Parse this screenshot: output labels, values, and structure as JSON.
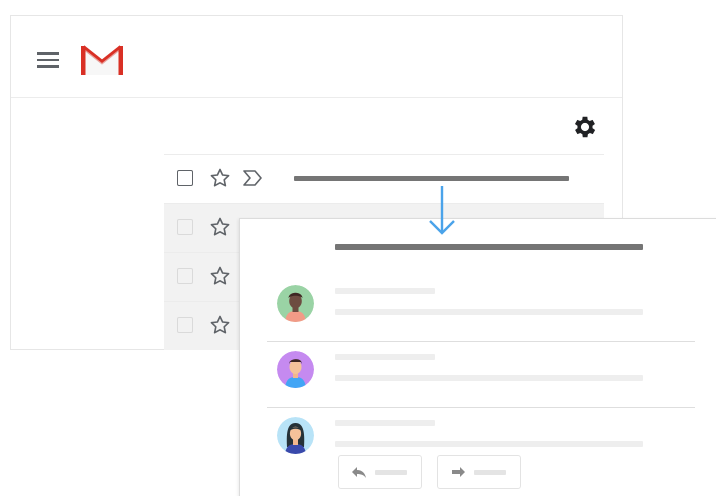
{
  "header": {
    "menu_icon": "hamburger-menu-icon",
    "logo": "gmail-m-logo",
    "settings_icon": "gear-icon"
  },
  "inbox": {
    "rows": [
      {
        "state": "active",
        "icons": [
          "checkbox-icon",
          "star-outline-icon",
          "important-marker-icon"
        ]
      },
      {
        "state": "faded",
        "icons": [
          "checkbox-icon",
          "star-outline-icon"
        ]
      },
      {
        "state": "faded",
        "icons": [
          "checkbox-icon",
          "star-outline-icon"
        ]
      },
      {
        "state": "faded",
        "icons": [
          "checkbox-icon",
          "star-outline-icon"
        ]
      }
    ]
  },
  "transition": {
    "arrow_icon": "down-arrow-icon"
  },
  "thread": {
    "messages": [
      {
        "avatar": "person-avatar-green"
      },
      {
        "avatar": "person-avatar-purple"
      },
      {
        "avatar": "person-avatar-blue"
      }
    ],
    "actions": [
      {
        "icon": "reply-arrow-icon"
      },
      {
        "icon": "forward-arrow-icon"
      }
    ]
  },
  "colors": {
    "gmail_red": "#d93025",
    "arrow_blue": "#4aa3ea",
    "icon_gray": "#5f6368",
    "bar_dark": "#757575",
    "bar_light": "#eeeeee",
    "row_faded": "#f2f2f2",
    "avatar_green": "#9ad3a5",
    "avatar_purple": "#c58af0",
    "avatar_blue": "#b8e3f7"
  }
}
